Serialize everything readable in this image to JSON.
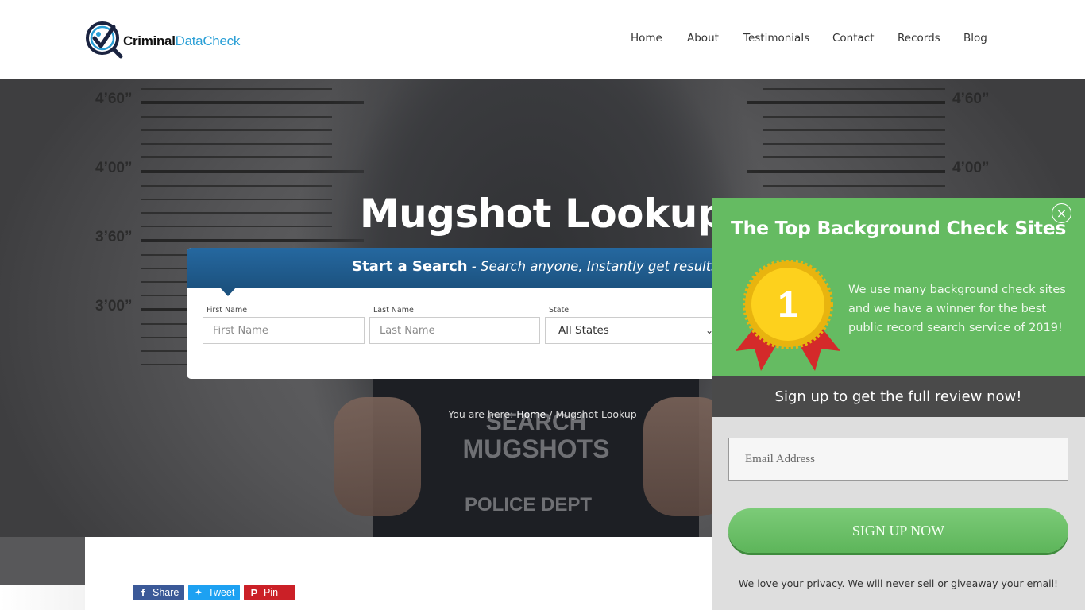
{
  "header": {
    "logo": {
      "part1": "Criminal",
      "part2": "DataCheck"
    },
    "nav": [
      {
        "label": "Home"
      },
      {
        "label": "About"
      },
      {
        "label": "Testimonials"
      },
      {
        "label": "Contact"
      },
      {
        "label": "Records"
      },
      {
        "label": "Blog"
      }
    ]
  },
  "hero": {
    "title": "Mugshot Lookup",
    "ruler_labels": [
      "4’60”",
      "4’00”",
      "3’60”",
      "3’00”"
    ],
    "board": {
      "line1": "SEARCH",
      "line2": "MUGSHOTS",
      "line3": "POLICE DEPT"
    },
    "breadcrumb": {
      "prefix": "You are here: ",
      "home": "Home",
      "separator": " / ",
      "current": "Mugshot Lookup"
    }
  },
  "search": {
    "heading_bold": "Start a Search",
    "heading_italic": " - Search anyone, Instantly get results",
    "first_name": {
      "label": "First Name",
      "placeholder": "First Name",
      "value": ""
    },
    "last_name": {
      "label": "Last Name",
      "placeholder": "Last Name",
      "value": ""
    },
    "state": {
      "label": "State",
      "selected": "All States"
    }
  },
  "share": {
    "facebook": {
      "label": "Share",
      "icon": "f",
      "color": "#3b5998"
    },
    "twitter": {
      "label": "Tweet",
      "icon": "🐦",
      "color": "#1da1f2"
    },
    "pinterest": {
      "label": "Pin",
      "icon": "P",
      "color": "#cb2027"
    }
  },
  "popup": {
    "title": "The Top Background Check Sites",
    "close_icon": "×",
    "medal_number": "1",
    "description": "We use many background check sites and we have a winner for the best public record search service of 2019!",
    "band_text": "Sign up to get the full review now!",
    "email": {
      "placeholder": "Email Address",
      "value": ""
    },
    "button_label": "SIGN UP NOW",
    "privacy": "We love your privacy.  We will never sell or giveaway your email!",
    "colors": {
      "green": "#65bb62",
      "band": "#4a4a4a",
      "bottom": "#dedede"
    }
  }
}
